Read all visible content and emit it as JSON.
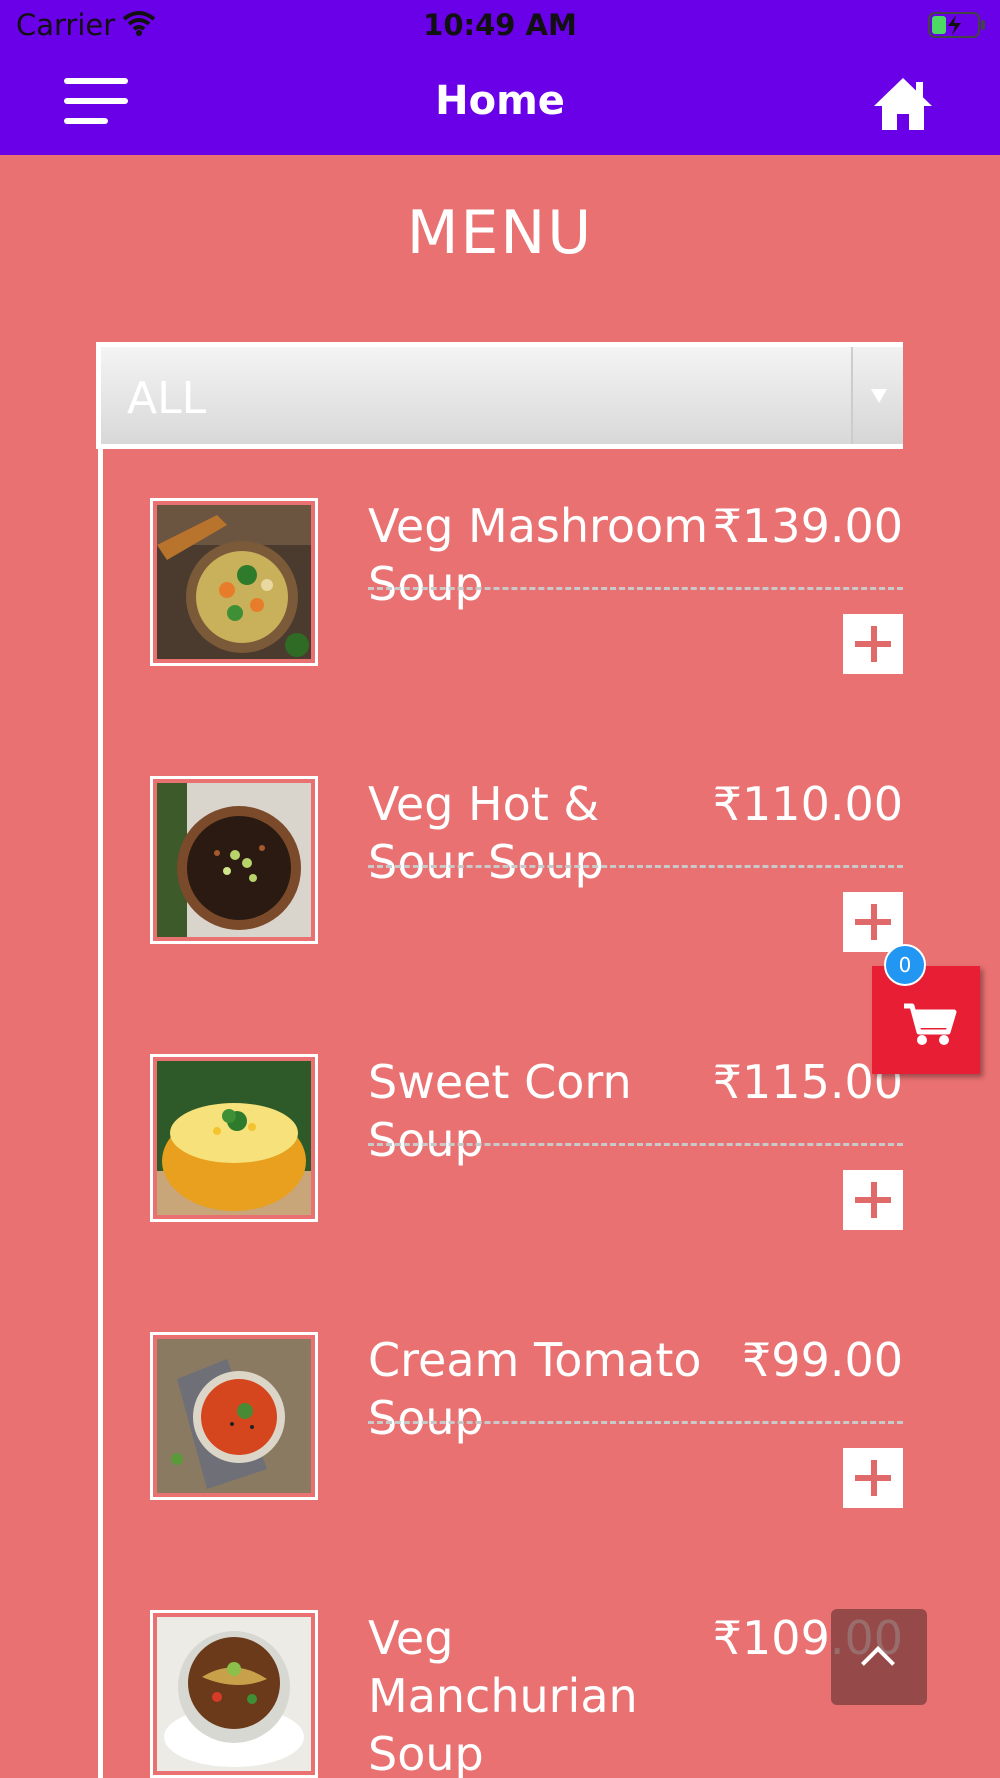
{
  "status_bar": {
    "carrier": "Carrier",
    "time": "10:49 AM"
  },
  "nav": {
    "title": "Home",
    "menu_icon": "hamburger-icon",
    "home_icon": "home-icon"
  },
  "page": {
    "heading": "MENU"
  },
  "filter": {
    "selected": "ALL"
  },
  "items": [
    {
      "name": "Veg Mashroom Soup",
      "price": "₹139.00"
    },
    {
      "name": "Veg Hot & Sour Soup",
      "price": "₹110.00"
    },
    {
      "name": "Sweet Corn Soup",
      "price": "₹115.00"
    },
    {
      "name": "Cream Tomato Soup",
      "price": "₹99.00"
    },
    {
      "name": "Veg Manchurian Soup",
      "price": "₹109.00"
    }
  ],
  "cart": {
    "count": "0",
    "icon": "cart-icon"
  },
  "scroll_top": {
    "icon": "chevron-up-icon"
  },
  "colors": {
    "nav": "#6a00e8",
    "background": "#e97171",
    "cart": "#e81e34",
    "badge": "#2196f3"
  }
}
